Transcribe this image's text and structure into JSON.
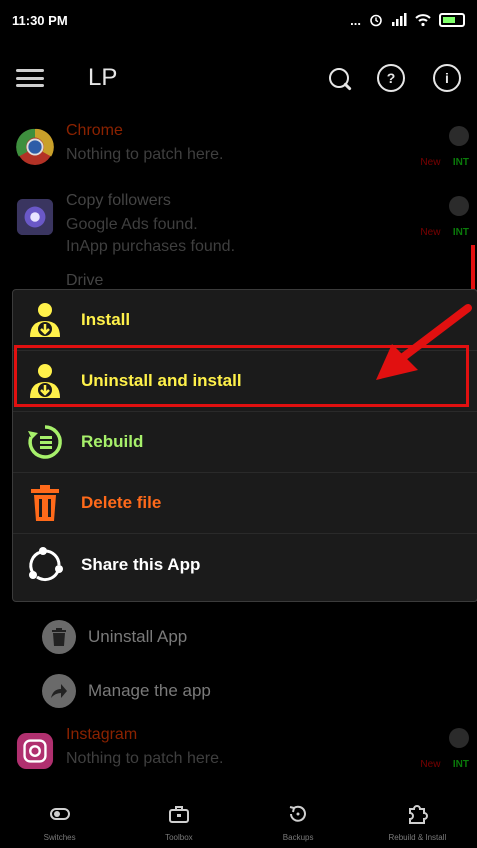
{
  "status": {
    "time": "11:30 PM",
    "dots": "...",
    "battery_color": "#7fff6a"
  },
  "appbar": {
    "title": "LP"
  },
  "apps": [
    {
      "name": "Chrome",
      "desc": [
        "Nothing to patch here."
      ],
      "tag_new": "New",
      "tag_int": "INT"
    },
    {
      "name": "Copy followers",
      "desc": [
        "Google Ads found.",
        "InApp purchases found."
      ],
      "tag_new": "New",
      "tag_int": "INT"
    },
    {
      "name": "Drive",
      "desc": [],
      "tag_new": "",
      "tag_int": ""
    }
  ],
  "menu": {
    "items": [
      {
        "label": "Install",
        "color": "#fff14a",
        "icon": "install-icon"
      },
      {
        "label": "Uninstall and install",
        "color": "#fff14a",
        "icon": "install-icon"
      },
      {
        "label": "Rebuild",
        "color": "#a7f06b",
        "icon": "rebuild-icon"
      },
      {
        "label": "Delete file",
        "color": "#ff6a1a",
        "icon": "trash-icon"
      },
      {
        "label": "Share this App",
        "color": "#ffffff",
        "icon": "share-icon"
      }
    ]
  },
  "bottom_list": [
    {
      "label": "Uninstall App",
      "icon": "trash-icon"
    },
    {
      "label": "Manage the app",
      "icon": "share-arrow-icon"
    }
  ],
  "instagram": {
    "name": "Instagram",
    "desc": "Nothing to patch here.",
    "tag_new": "New",
    "tag_int": "INT"
  },
  "bottomnav": [
    {
      "label": "Switches",
      "icon": "switch-icon"
    },
    {
      "label": "Toolbox",
      "icon": "toolbox-icon"
    },
    {
      "label": "Backups",
      "icon": "backup-icon"
    },
    {
      "label": "Rebuild & Install",
      "icon": "puzzle-icon"
    }
  ],
  "colors": {
    "highlight": "#e11010"
  }
}
